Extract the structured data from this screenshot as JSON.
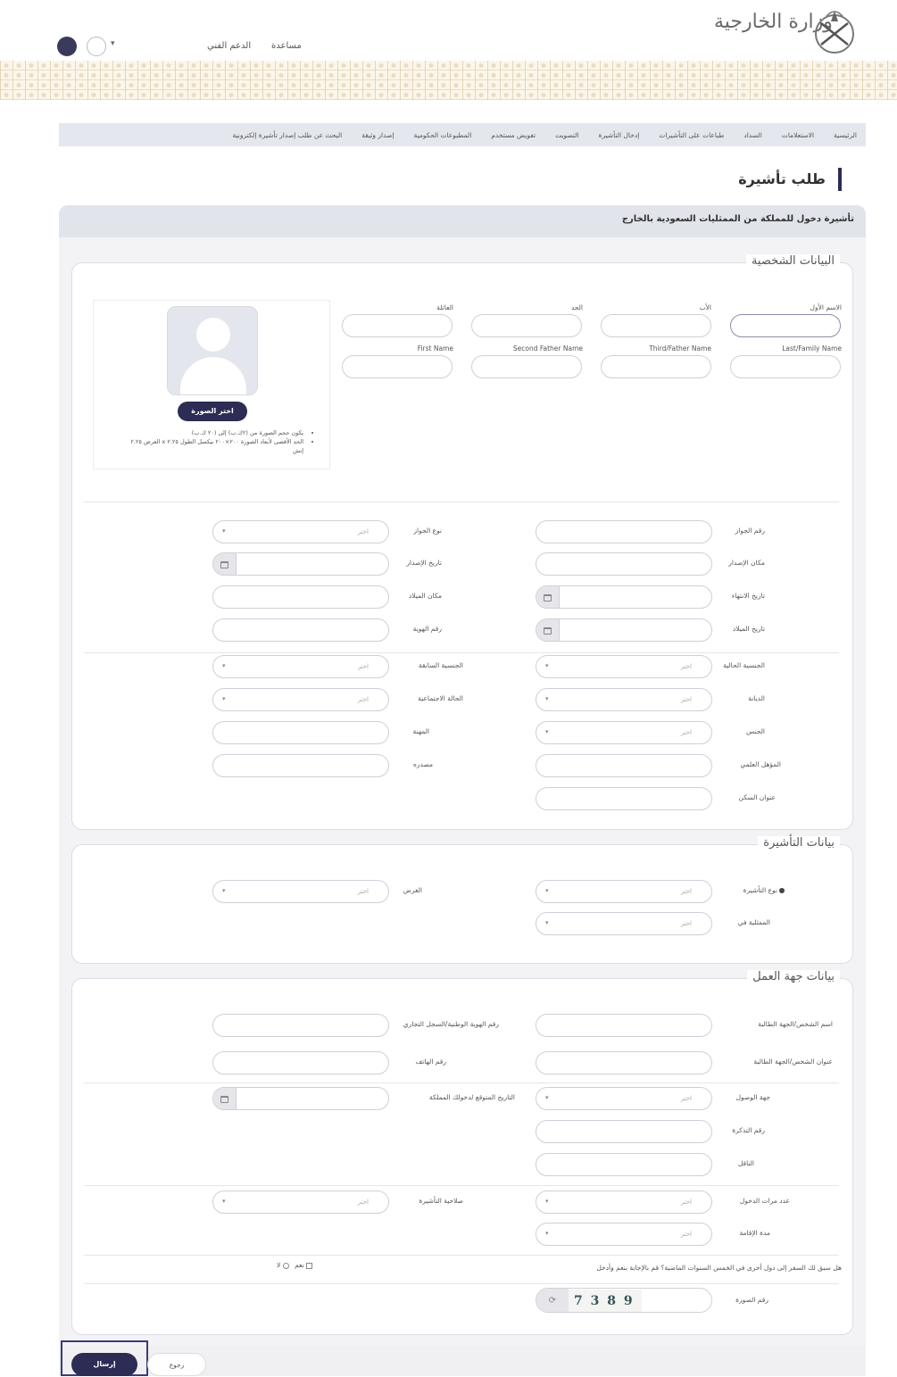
{
  "header": {
    "logo_text": "وزارة الخارجية",
    "help": "مساعدة",
    "support": "الدعم الفني"
  },
  "nav": [
    "الرئيسية",
    "الاستعلامات",
    "السداد",
    "طباعات على التأشيرات",
    "إدخال التأشيرة",
    "التصويت",
    "تفويض مستخدم",
    "المطبوعات الحكومية",
    "إصدار وثيقة",
    "البحث عن طلب إصدار تأشيرة إلكترونية"
  ],
  "page_title": "طلب تأشيرة",
  "panel_title": "تأشيرة دخول للمملكة من الممثليات السعودية بالخارج",
  "personal": {
    "legend": "البيانات الشخصية",
    "ar_names": {
      "first": "الاسم الأول",
      "father": "الأب",
      "grand": "الجد",
      "family": "العائلة"
    },
    "en_names": {
      "last": "Last/Family Name",
      "third": "Third/Father Name",
      "second": "Second Father Name",
      "first": "First Name"
    },
    "photo_button": "اختر الصورة",
    "photo_note_1": "يكون حجم الصورة من (٢ك.ب) إلى (٢٠ ك.ب)",
    "photo_note_2": "الحد الأقصى لأبعاد الصورة ٢٠٠×٢٠٠ بيكسل الطول ٢.٢٥ x العرض ٢.٢٥",
    "photo_note_3": "إنش",
    "labels": {
      "passport_no": "رقم الجواز",
      "passport_type": "نوع الجواز",
      "issue_place": "مكان الإصدار",
      "issue_date": "تاريخ الإصدار",
      "birth_date": "تاريخ الميلاد",
      "birth_place": "مكان الميلاد",
      "expiry_date": "تاريخ الانتهاء",
      "id_no": "رقم الهوية",
      "current_nationality": "الجنسية الحالية",
      "previous_nationality": "الجنسية السابقة",
      "religion": "الديانة",
      "marital": "الحالة الاجتماعية",
      "gender": "الجنس",
      "profession": "المهنة",
      "qualification": "المؤهل العلمي",
      "source": "مصدره",
      "address": "عنوان السكن"
    },
    "select_placeholder": "اختر"
  },
  "visa": {
    "legend": "بيانات التأشيرة",
    "visa_type": "نوع التأشيرة",
    "purpose": "الغرض",
    "mission": "الممثلية في"
  },
  "work": {
    "legend": "بيانات جهة العمل",
    "employer_name": "اسم الشخص/الجهة الطالبة",
    "employer_id": "رقم الهوية الوطنية/السجل التجاري",
    "employer_address": "عنوان الشخص/الجهة الطالبة",
    "phone": "رقم الهاتف",
    "arrival_port": "جهة الوصول",
    "expected_date": "التاريخ المتوقع لدخولك المملكة",
    "ticket": "رقم التذكرة",
    "carrier": "الناقل",
    "entries": "عدد مرات الدخول",
    "validity": "صلاحية التأشيرة",
    "stay": "مدة الإقامة",
    "question": "هل سبق لك السفر إلى دول أخرى في الخمس السنوات الماضية؟ قم بالإجابة بنعم وأدخل",
    "yes": "نعم",
    "no": "لا",
    "captcha_label": "رقم الصورة",
    "captcha_text": "7 3 8 9 5"
  },
  "actions": {
    "submit": "إرسال",
    "back": "رجوع"
  }
}
